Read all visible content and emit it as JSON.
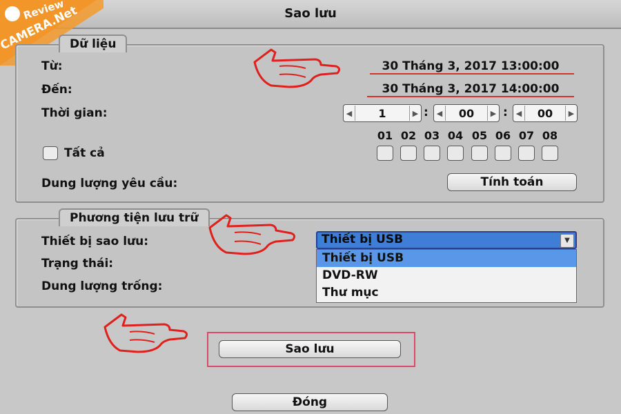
{
  "window": {
    "title": "Sao lưu"
  },
  "watermark": {
    "line1": "Review",
    "line2": "CAMERA.Net"
  },
  "data_section": {
    "legend": "Dữ liệu",
    "from_label": "Từ:",
    "from_value": "30 Tháng 3, 2017 13:00:00",
    "to_label": "Đến:",
    "to_value": "30 Tháng 3, 2017 14:00:00",
    "duration_label": "Thời gian:",
    "duration_hours": "1",
    "duration_minutes": "00",
    "duration_seconds": "00",
    "all_label": "Tất cả",
    "channels": [
      "01",
      "02",
      "03",
      "04",
      "05",
      "06",
      "07",
      "08"
    ],
    "required_size_label": "Dung lượng yêu cầu:",
    "calculate_button": "Tính toán"
  },
  "storage_section": {
    "legend": "Phương tiện lưu trữ",
    "device_label": "Thiết bị sao lưu:",
    "status_label": "Trạng thái:",
    "free_space_label": "Dung lượng trống:",
    "device_selected": "Thiết bị USB",
    "device_options": [
      "Thiết bị USB",
      "DVD-RW",
      "Thư mục"
    ]
  },
  "actions": {
    "backup_button": "Sao lưu",
    "close_button": "Đóng"
  },
  "colors": {
    "accent_underline": "#d9302c",
    "select_highlight": "#3f7ed6",
    "annotation_red": "#e0201c"
  },
  "icons": [
    "pointing-hand-icon",
    "left-arrow-icon",
    "right-arrow-icon",
    "chevron-down-icon"
  ]
}
